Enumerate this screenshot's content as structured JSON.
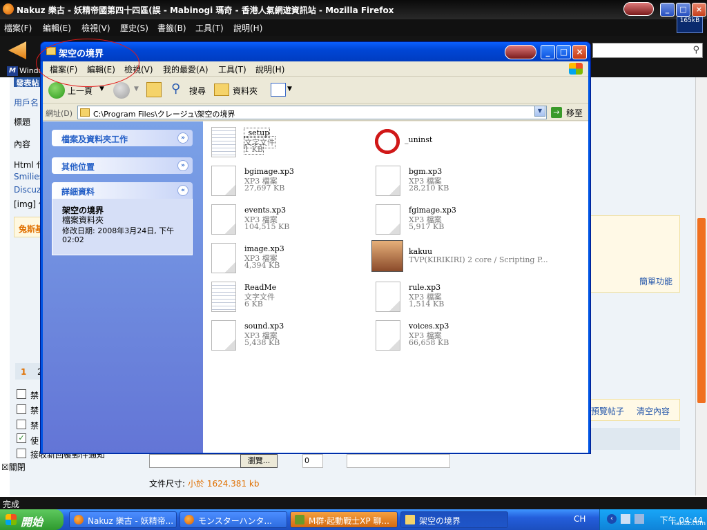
{
  "firefox": {
    "title": "Nakuz 樂古 - 妖精帝國第四十四區(誤 - Mabinogi 瑪奇 - 香港人氣網遊資訊站 - Mozilla Firefox",
    "menu": [
      "檔案(F)",
      "編輯(E)",
      "檢視(V)",
      "歷史(S)",
      "書籤(B)",
      "工具(T)",
      "說明(H)"
    ],
    "speed": "165kB",
    "bookmark": "Windo",
    "status": "完成"
  },
  "forum": {
    "tab_post": "發表帖",
    "username": "用戶名",
    "subject": "標題",
    "content": "內容",
    "html": "Html 代",
    "smilies": "Smilies",
    "discuz": "Discuz!",
    "img": "[img] 代",
    "emoticon_tab": "兔斯基",
    "page1": "1",
    "page2": "2",
    "checks": [
      "禁",
      "禁",
      "禁",
      "使",
      "接收新回覆郵件通知"
    ],
    "close": "關閉",
    "simple": "簡單功能",
    "preview": "預覽帖子",
    "clear": "清空內容",
    "browse": "瀏覽...",
    "zero": "0",
    "filesize_label": "文件尺寸:",
    "filesize_value": "小於 1624.381 kb"
  },
  "explorer": {
    "title": "架空の境界",
    "menu": [
      "檔案(F)",
      "編輯(E)",
      "檢視(V)",
      "我的最愛(A)",
      "工具(T)",
      "說明(H)"
    ],
    "toolbar": {
      "back": "上一頁",
      "search": "搜尋",
      "folders": "資料夾"
    },
    "address": {
      "label": "網址(D)",
      "value": "C:\\Program Files\\クレージュ\\架空の境界",
      "go": "移至"
    },
    "left": {
      "tasks": "檔案及資料夾工作",
      "other": "其他位置",
      "details": "詳細資料",
      "detail_name": "架空の境界",
      "detail_kind": "檔案資料夾",
      "detail_date": "修改日期: 2008年3月24日, 下午 02:02"
    },
    "files": [
      {
        "name": "_setup",
        "type": "文字文件",
        "size": "1 KB",
        "icon": "text-file-icon"
      },
      {
        "name": "_uninst",
        "type": "",
        "size": "",
        "icon": "uninstall-icon"
      },
      {
        "name": "bgimage.xp3",
        "type": "XP3 檔案",
        "size": "27,697 KB",
        "icon": "file-icon"
      },
      {
        "name": "bgm.xp3",
        "type": "XP3 檔案",
        "size": "28,210 KB",
        "icon": "file-icon"
      },
      {
        "name": "events.xp3",
        "type": "XP3 檔案",
        "size": "104,515 KB",
        "icon": "file-icon"
      },
      {
        "name": "fgimage.xp3",
        "type": "XP3 檔案",
        "size": "5,917 KB",
        "icon": "file-icon"
      },
      {
        "name": "image.xp3",
        "type": "XP3 檔案",
        "size": "4,394 KB",
        "icon": "file-icon"
      },
      {
        "name": "kakuu",
        "type": "TVP(KIRIKIRI) 2 core / Scripting P...",
        "size": "",
        "icon": "anime-girl-icon"
      },
      {
        "name": "ReadMe",
        "type": "文字文件",
        "size": "6 KB",
        "icon": "text-file-icon"
      },
      {
        "name": "rule.xp3",
        "type": "XP3 檔案",
        "size": "1,514 KB",
        "icon": "file-icon"
      },
      {
        "name": "sound.xp3",
        "type": "XP3 檔案",
        "size": "5,438 KB",
        "icon": "file-icon"
      },
      {
        "name": "voices.xp3",
        "type": "XP3 檔案",
        "size": "66,658 KB",
        "icon": "file-icon"
      }
    ]
  },
  "taskbar": {
    "start": "開始",
    "tasks": [
      "Nakuz 樂古 - 妖精帝...",
      "モンスターハンタ...",
      "M群·起動戰士XP 聊...",
      "架空の境界"
    ],
    "lang": "CH",
    "clock": "下午 04:44",
    "watermark": "nakuz.com"
  },
  "colors": {
    "xp_blue": "#0054e3",
    "taskbar_blue": "#245edb",
    "start_green": "#3c9a3c",
    "forum_orange": "#e07000"
  }
}
